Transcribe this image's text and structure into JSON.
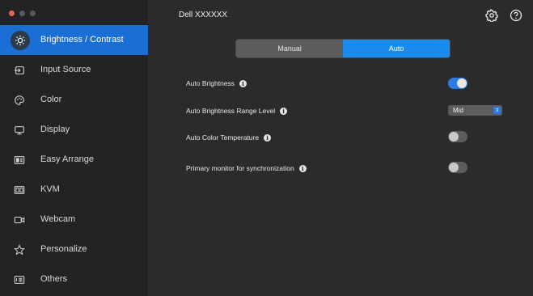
{
  "window": {
    "title": "Dell XXXXXX"
  },
  "sidebar": {
    "items": [
      {
        "label": "Brightness / Contrast",
        "icon": "brightness-icon",
        "active": true
      },
      {
        "label": "Input Source",
        "icon": "input-source-icon"
      },
      {
        "label": "Color",
        "icon": "color-palette-icon"
      },
      {
        "label": "Display",
        "icon": "display-icon"
      },
      {
        "label": "Easy Arrange",
        "icon": "easy-arrange-icon"
      },
      {
        "label": "KVM",
        "icon": "kvm-icon"
      },
      {
        "label": "Webcam",
        "icon": "webcam-icon"
      },
      {
        "label": "Personalize",
        "icon": "star-icon"
      },
      {
        "label": "Others",
        "icon": "others-icon"
      }
    ]
  },
  "header": {
    "settings_icon": "gear-icon",
    "help_icon": "help-icon"
  },
  "mode": {
    "options": [
      "Manual",
      "Auto"
    ],
    "selected": "Auto"
  },
  "settings": {
    "auto_brightness": {
      "label": "Auto Brightness",
      "enabled": true
    },
    "range_level": {
      "label": "Auto Brightness Range Level",
      "value": "Mid"
    },
    "auto_color_temp": {
      "label": "Auto Color Temperature",
      "enabled": false
    },
    "primary_sync": {
      "label": "Primary monitor for synchronization",
      "enabled": false
    }
  },
  "colors": {
    "accent": "#1a8cf0",
    "active_nav": "#1a6fd6"
  }
}
